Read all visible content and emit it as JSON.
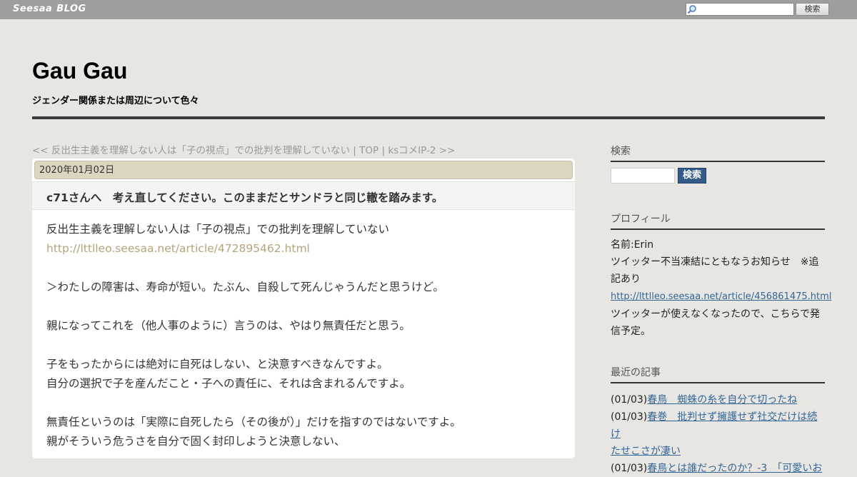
{
  "topbar": {
    "logo_seesaa": "Seesaa",
    "logo_blog": "BLOG",
    "search_placeholder": "",
    "search_button": "検索"
  },
  "header": {
    "title": "Gau Gau",
    "description": "ジェンダー関係または周辺について色々"
  },
  "nav": {
    "prev": "<< 反出生主義を理解しない人は「子の視点」での批判を理解していない",
    "sep1": " | ",
    "top": "TOP",
    "sep2": " | ",
    "next": "ksコメIP-2 >>"
  },
  "article": {
    "date": "2020年01月02日",
    "title": "c71さんへ　考え直してください。このままだとサンドラと同じ轍を踏みます。",
    "lines": [
      "反出生主義を理解しない人は「子の視点」での批判を理解していない",
      "http://lttlleo.seesaa.net/article/472895462.html",
      "",
      "＞わたしの障害は、寿命が短い。たぶん、自殺して死んじゃうんだと思うけど。",
      "",
      "親になってこれを（他人事のように）言うのは、やはり無責任だと思う。",
      "",
      "子をもったからには絶対に自死はしない、と決意すべきなんですよ。",
      "自分の選択で子を産んだこと・子への責任に、それは含まれるんですよ。",
      "",
      "無責任というのは「実際に自死したら（その後が）」だけを指すのではないですよ。",
      "親がそういう危うさを自分で固く封印しようと決意しない、"
    ]
  },
  "sidebar": {
    "search": {
      "heading": "検索",
      "button": "検索"
    },
    "profile": {
      "heading": "プロフィール",
      "name": "名前:Erin",
      "notice1": "ツイッター不当凍結にともなうお知らせ　※追",
      "notice2": "記あり",
      "link": "http://lttlleo.seesaa.net/article/456861475.html",
      "notice3": "ツイッターが使えなくなったので、こちらで発",
      "notice4": "信予定。"
    },
    "recent": {
      "heading": "最近の記事",
      "items": [
        {
          "date": "(01/03)",
          "title_1": "春鳥　蜘蛛の糸を自分で切ったね",
          "title_2": ""
        },
        {
          "date": "(01/03)",
          "title_1": "春巻　批判せず擁護せず社交だけは続け",
          "title_2": "たせこさが凄い"
        },
        {
          "date": "(01/03)",
          "title_1": "春鳥とは誰だったのか？-3　「可愛いお",
          "title_2": ""
        }
      ]
    }
  }
}
